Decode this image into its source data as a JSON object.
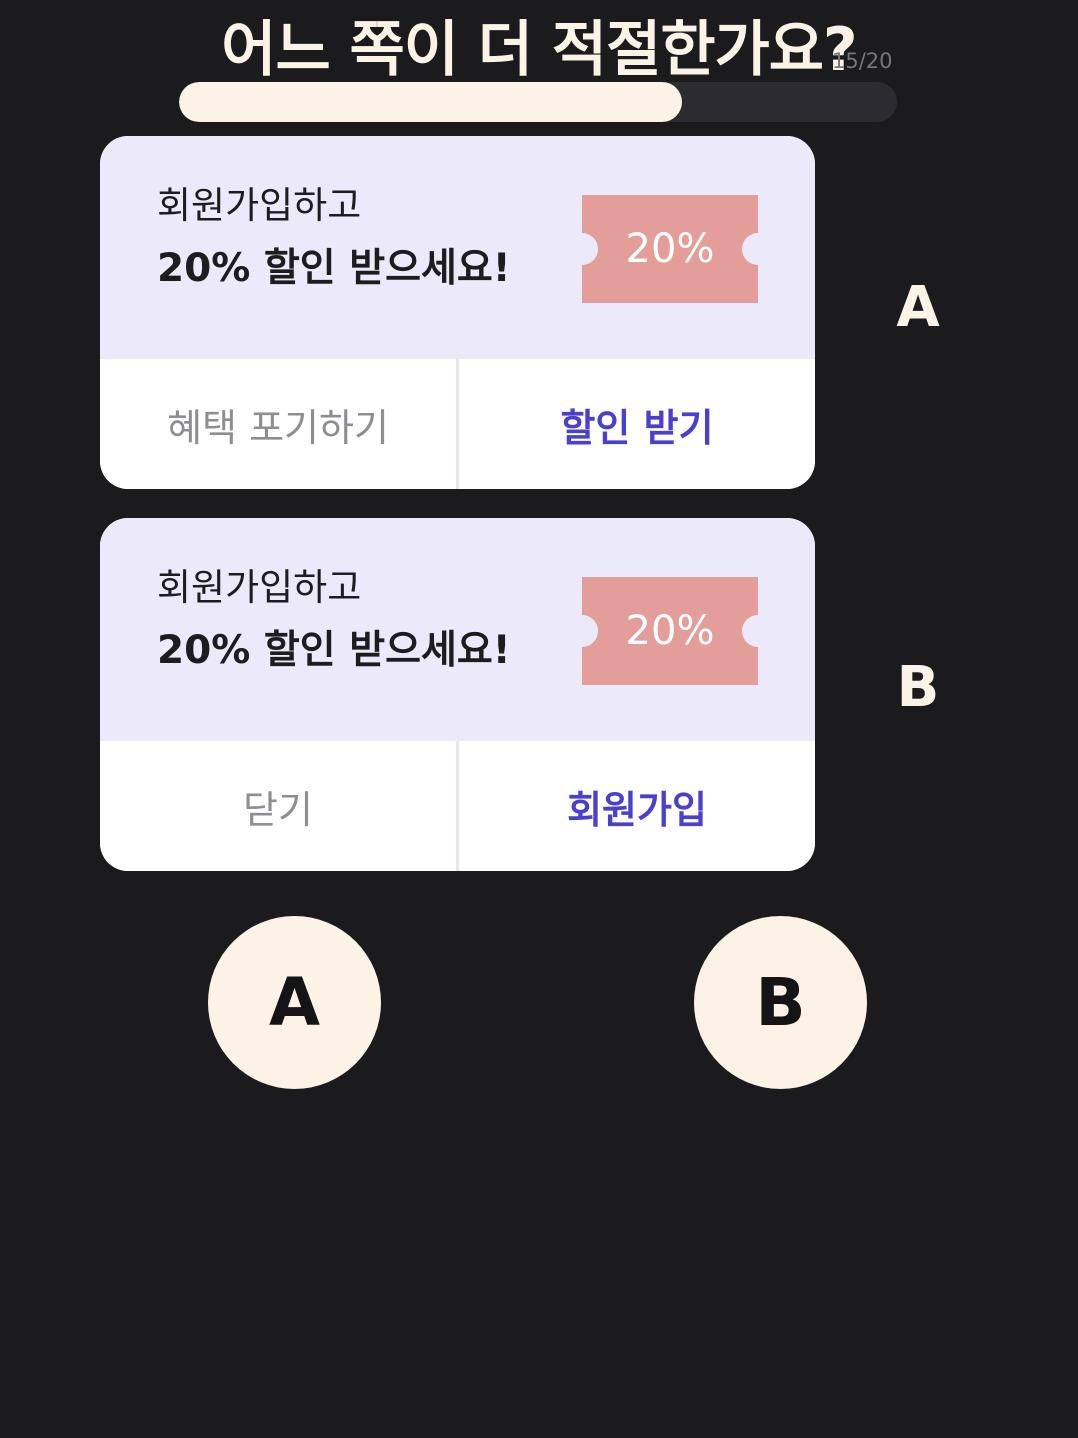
{
  "header": {
    "title": "어느 쪽이 더 적절한가요?",
    "counter": "15/20",
    "progress": 0.7
  },
  "option_a": {
    "line1": "회원가입하고",
    "line2": "20% 할인 받으세요!",
    "coupon": "20%",
    "left_button": "혜택 포기하기",
    "right_button": "할인 받기",
    "label": "A"
  },
  "option_b": {
    "line1": "회원가입하고",
    "line2": "20% 할인 받으세요!",
    "coupon": "20%",
    "left_button": "닫기",
    "right_button": "회원가입",
    "label": "B"
  },
  "choices": {
    "a": "A",
    "b": "B"
  },
  "colors": {
    "background": "#1b1a1d",
    "cream": "#fcf2e5",
    "card_top": "#ece9fa",
    "coupon": "#e49e99",
    "accent": "#4b3fd0"
  }
}
